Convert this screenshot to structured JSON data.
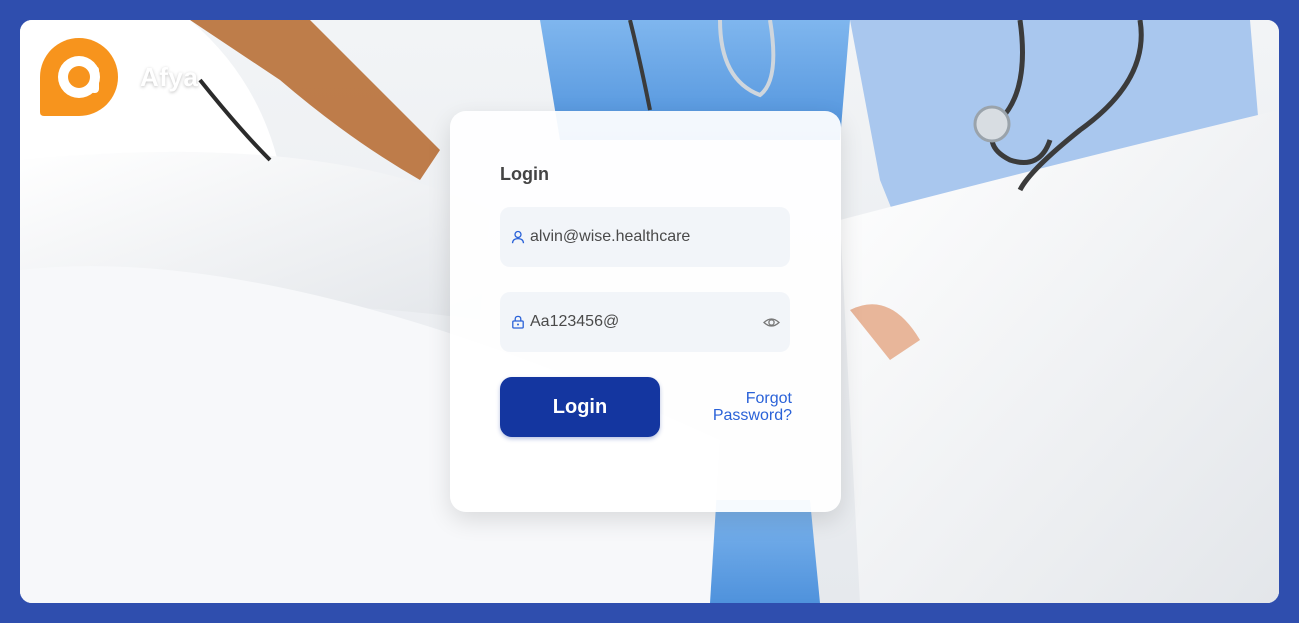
{
  "brand": {
    "name": "Afya",
    "logo_icon": "speech-bubble-a-logo-icon"
  },
  "login_form": {
    "title": "Login",
    "email_value": "alvin@wise.healthcare",
    "email_icon": "user-icon",
    "password_value": "Aa123456@",
    "password_icon": "lock-icon",
    "show_password_icon": "eye-icon",
    "login_button_label": "Login",
    "forgot_password_label": "Forgot Password?"
  },
  "colors": {
    "page_background": "#2f4eae",
    "accent": "#1436a0",
    "link": "#2a62d8",
    "logo_orange": "#f7941d",
    "icon_blue": "#2a62d8"
  }
}
